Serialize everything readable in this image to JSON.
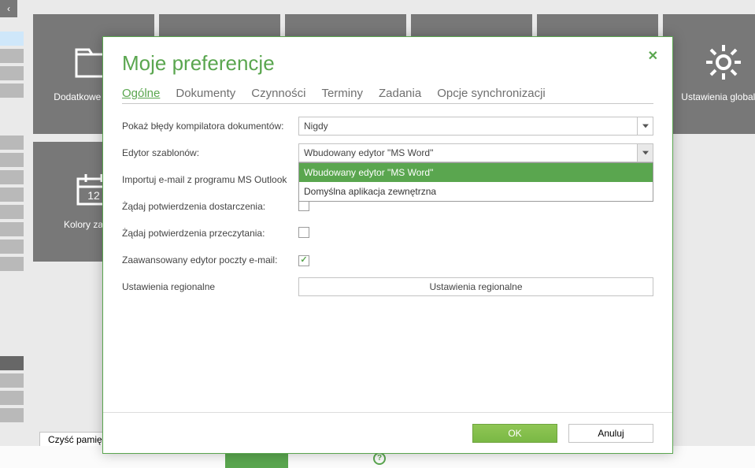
{
  "bg_tiles_top": [
    {
      "label": "Dodatkowe\nsprawy",
      "icon": "folder"
    },
    {
      "label": "",
      "icon": ""
    },
    {
      "label": "",
      "icon": ""
    },
    {
      "label": "",
      "icon": ""
    },
    {
      "label": "",
      "icon": ""
    },
    {
      "label": "Ustawienia globalne",
      "icon": "gear"
    }
  ],
  "bg_tiles_bot": [
    {
      "label": "Kolory zadań i",
      "icon": "calendar"
    }
  ],
  "left_handle_icon": "‹",
  "footer_button": "Czyść pamięć",
  "modal": {
    "title": "Moje preferencje",
    "close": "✕",
    "tabs": [
      "Ogólne",
      "Dokumenty",
      "Czynności",
      "Terminy",
      "Zadania",
      "Opcje synchronizacji"
    ],
    "active_tab": 0,
    "rows": {
      "compiler_errors_label": "Pokaż błędy kompilatora dokumentów:",
      "compiler_errors_value": "Nigdy",
      "template_editor_label": "Edytor szablonów:",
      "template_editor_value": "Wbudowany edytor \"MS Word\"",
      "template_editor_options": [
        "Wbudowany edytor \"MS Word\"",
        "Domyślna aplikacja zewnętrzna"
      ],
      "outlook_import_label": "Importuj e-mail z programu MS Outlook",
      "delivery_confirm_label": "Żądaj potwierdzenia dostarczenia:",
      "read_confirm_label": "Żądaj potwierdzenia przeczytania:",
      "advanced_email_label": "Zaawansowany edytor poczty e-mail:",
      "regional_label": "Ustawienia regionalne",
      "regional_button": "Ustawienia regionalne"
    },
    "buttons": {
      "ok": "OK",
      "cancel": "Anuluj"
    }
  }
}
